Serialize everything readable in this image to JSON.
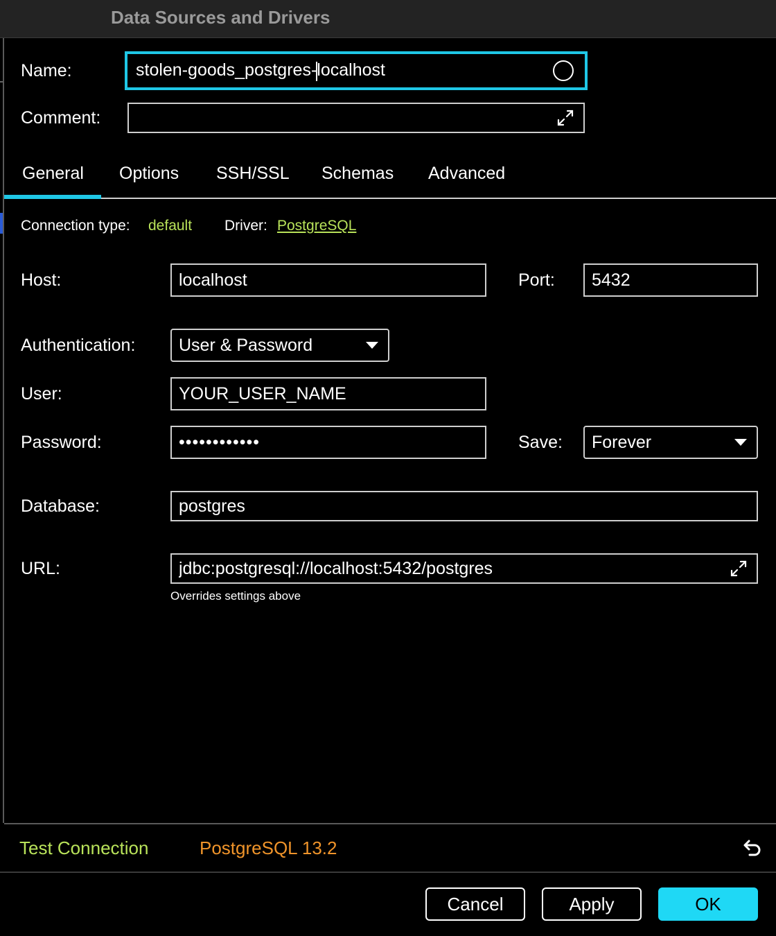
{
  "window": {
    "title": "Data Sources and Drivers"
  },
  "name": {
    "label": "Name:",
    "value_before_cursor": "stolen-goods_postgres-",
    "value_after_cursor": "localhost"
  },
  "comment": {
    "label": "Comment:",
    "value": ""
  },
  "tabs": [
    {
      "label": "General",
      "active": true
    },
    {
      "label": "Options"
    },
    {
      "label": "SSH/SSL"
    },
    {
      "label": "Schemas"
    },
    {
      "label": "Advanced"
    }
  ],
  "connection": {
    "type_label": "Connection type:",
    "type_value": "default",
    "driver_label": "Driver:",
    "driver_value": "PostgreSQL"
  },
  "host": {
    "label": "Host:",
    "value": "localhost"
  },
  "port": {
    "label": "Port:",
    "value": "5432"
  },
  "auth": {
    "label": "Authentication:",
    "value": "User & Password"
  },
  "user": {
    "label": "User:",
    "value": "YOUR_USER_NAME"
  },
  "password": {
    "label": "Password:",
    "value": "••••••••••••"
  },
  "save": {
    "label": "Save:",
    "value": "Forever"
  },
  "database": {
    "label": "Database:",
    "value": "postgres"
  },
  "url": {
    "label": "URL:",
    "value": "jdbc:postgresql://localhost:5432/postgres",
    "hint": "Overrides settings above"
  },
  "footer": {
    "test_connection": "Test Connection",
    "version": "PostgreSQL 13.2"
  },
  "buttons": {
    "cancel": "Cancel",
    "apply": "Apply",
    "ok": "OK"
  },
  "colors": {
    "accent": "#1fc7e6",
    "primary_button": "#1fd8f5",
    "link_green": "#b9e35a",
    "version_orange": "#f0942a"
  }
}
